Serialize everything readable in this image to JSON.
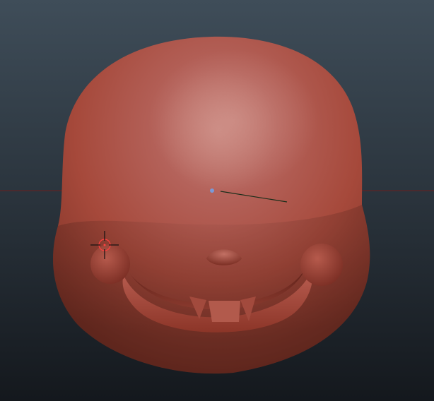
{
  "app": {
    "type": "3d-sculpting-viewport",
    "model": {
      "description_shape": "head",
      "base_color": "#a6493b",
      "highlight_color": "#c8857d",
      "shadow_color": "#6b2a22"
    },
    "background": {
      "gradient_top": "#3f4d59",
      "gradient_bottom": "#14181d"
    },
    "horizon_line_color": "#6a1f1f",
    "cursor": {
      "type": "brush-cursor",
      "color": "#ff4040"
    },
    "gizmo": {
      "pivot_color": "#7a9ad8",
      "line_color": "#1a2e1a"
    }
  }
}
